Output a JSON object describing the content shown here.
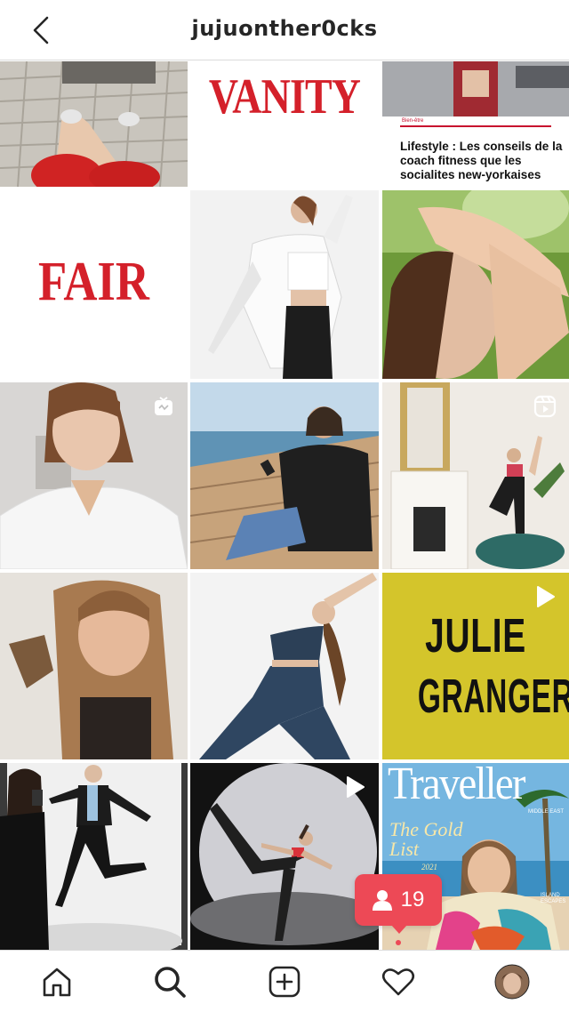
{
  "header": {
    "username": "jujuonther0cks"
  },
  "grid": {
    "tiles": [
      {
        "kind": "photo",
        "subject": "pavement-legs"
      },
      {
        "kind": "magazine",
        "text": "VANITY"
      },
      {
        "kind": "article",
        "tag": "Bien-être",
        "headline": "Lifestyle : Les conseils de la coach fitness que les socialites new-yorkaises"
      },
      {
        "kind": "magazine",
        "text": "FAIR"
      },
      {
        "kind": "photo",
        "subject": "white-jacket-pose"
      },
      {
        "kind": "photo",
        "subject": "stretch-outdoor"
      },
      {
        "kind": "photo",
        "subject": "white-shirt-portrait",
        "indicator": "igtv-icon"
      },
      {
        "kind": "photo",
        "subject": "beach-phone"
      },
      {
        "kind": "photo",
        "subject": "yoga-room",
        "indicator": "reel-icon"
      },
      {
        "kind": "photo",
        "subject": "funny-face"
      },
      {
        "kind": "photo",
        "subject": "yoga-stretch"
      },
      {
        "kind": "cover",
        "line1": "JULIE",
        "line2": "GRANGER",
        "indicator": "play-icon"
      },
      {
        "kind": "photo",
        "subject": "mirror-jump"
      },
      {
        "kind": "photo",
        "subject": "dance-spotlight",
        "indicator": "play-icon"
      },
      {
        "kind": "cover",
        "masthead": "Traveller",
        "region": "MIDDLE EAST",
        "script": "The Gold List",
        "year": "2021",
        "side": "ISLAND ESCAPES"
      }
    ]
  },
  "activity_popup": {
    "count": "19",
    "icon": "person-icon"
  },
  "bottom_nav": {
    "items": [
      "home-icon",
      "search-icon",
      "new-post-icon",
      "heart-icon",
      "profile-avatar"
    ]
  },
  "colors": {
    "accent_red": "#ed4956",
    "cover_yellow": "#d4c52b",
    "vanity_red": "#d4202a"
  }
}
